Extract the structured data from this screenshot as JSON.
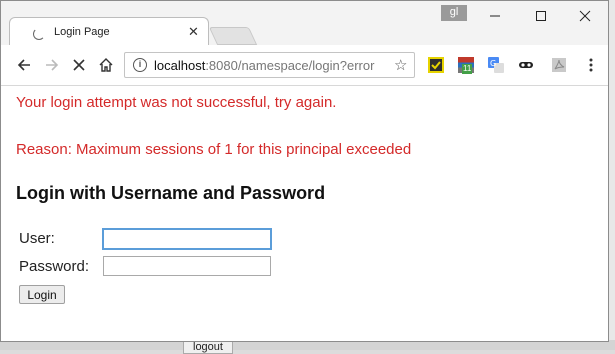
{
  "browser": {
    "user_badge": "gl",
    "tab": {
      "title": "Login Page"
    },
    "address_bar": {
      "host": "localhost",
      "rest": ":8080/namespace/login?error"
    },
    "extension_badge": "11"
  },
  "page": {
    "error_message": "Your login attempt was not successful, try again.",
    "reason": "Reason: Maximum sessions of 1 for this principal exceeded",
    "heading": "Login with Username and Password",
    "username_label": "User:",
    "username_value": "",
    "password_label": "Password:",
    "password_value": "",
    "login_button": "Login"
  },
  "background": {
    "logout_button": "logout"
  },
  "colors": {
    "error": "#d42a2a",
    "focus": "#5b9dd9"
  },
  "icons": [
    "loading-spinner-icon",
    "close-icon",
    "minimize-icon",
    "maximize-icon",
    "back-icon",
    "forward-icon",
    "stop-icon",
    "home-icon",
    "info-icon",
    "star-icon",
    "menu-icon"
  ]
}
